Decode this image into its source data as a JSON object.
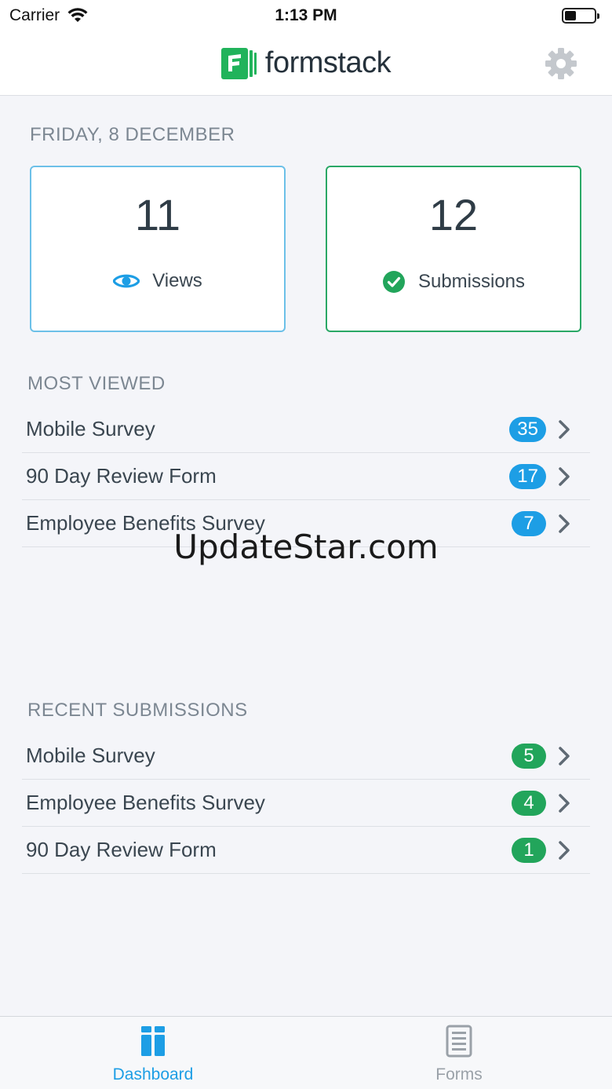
{
  "status_bar": {
    "carrier": "Carrier",
    "time": "1:13 PM"
  },
  "header": {
    "logo_text": "formstack",
    "settings_icon": "gear-icon"
  },
  "dashboard": {
    "date": "FRIDAY, 8 DECEMBER",
    "views": {
      "count": "11",
      "label": "Views",
      "icon": "eye-icon"
    },
    "submissions": {
      "count": "12",
      "label": "Submissions",
      "icon": "check-circle-icon"
    }
  },
  "most_viewed": {
    "title": "MOST VIEWED",
    "items": [
      {
        "name": "Mobile Survey",
        "count": "35"
      },
      {
        "name": "90 Day Review Form",
        "count": "17"
      },
      {
        "name": "Employee Benefits Survey",
        "count": "7"
      }
    ]
  },
  "recent_submissions": {
    "title": "RECENT SUBMISSIONS",
    "items": [
      {
        "name": "Mobile Survey",
        "count": "5"
      },
      {
        "name": "Employee Benefits Survey",
        "count": "4"
      },
      {
        "name": "90 Day Review Form",
        "count": "1"
      }
    ]
  },
  "watermark": "UpdateStar.com",
  "tabs": [
    {
      "label": "Dashboard",
      "icon": "dashboard-icon",
      "active": true
    },
    {
      "label": "Forms",
      "icon": "forms-icon",
      "active": false
    }
  ],
  "colors": {
    "views_border": "#6cc0e8",
    "submissions_border": "#2aa866",
    "badge_blue": "#1d9ee5",
    "badge_green": "#22a55b",
    "brand_green": "#21b35b"
  }
}
